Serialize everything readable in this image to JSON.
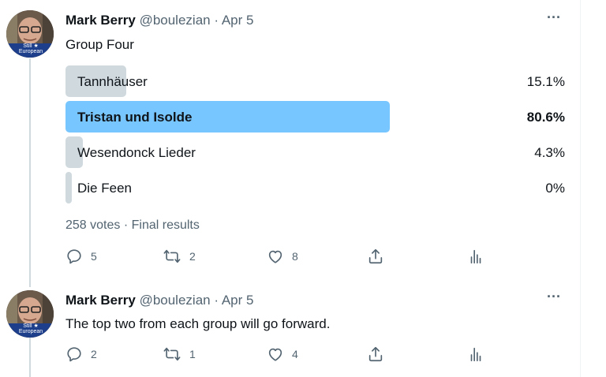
{
  "tweets": [
    {
      "author": {
        "name": "Mark Berry",
        "handle": "@boulezian",
        "date": "Apr 5",
        "avatar_badge": "Still ★ European"
      },
      "text": "Group Four",
      "poll": {
        "options": [
          {
            "label": "Tannhäuser",
            "percent": "15.1%",
            "fraction": 0.151,
            "winner": false
          },
          {
            "label": "Tristan und Isolde",
            "percent": "80.6%",
            "fraction": 0.806,
            "winner": true
          },
          {
            "label": "Wesendonck Lieder",
            "percent": "4.3%",
            "fraction": 0.043,
            "winner": false
          },
          {
            "label": "Die Feen",
            "percent": "0%",
            "fraction": 0.0,
            "winner": false
          }
        ],
        "votes": "258 votes",
        "status": "Final results"
      },
      "actions": {
        "replies": "5",
        "retweets": "2",
        "likes": "8"
      }
    },
    {
      "author": {
        "name": "Mark Berry",
        "handle": "@boulezian",
        "date": "Apr 5",
        "avatar_badge": "Still ★ European"
      },
      "text": "The top two from each group will go forward.",
      "actions": {
        "replies": "2",
        "retweets": "1",
        "likes": "4"
      }
    }
  ],
  "ui": {
    "dot": "·",
    "more": "···"
  },
  "colors": {
    "winner_bar": "#78c6ff",
    "bar": "#cfd9de",
    "secondary_text": "#536471"
  }
}
